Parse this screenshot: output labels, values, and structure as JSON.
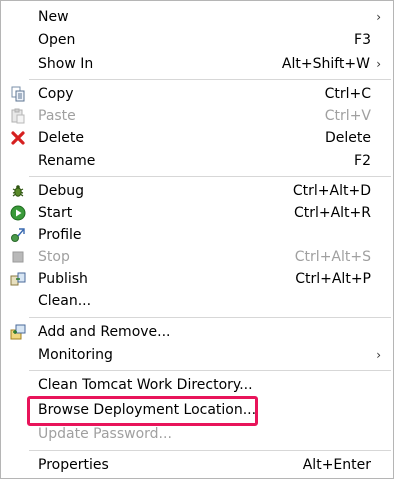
{
  "menu": {
    "new": {
      "label": "New",
      "arrow": "›"
    },
    "open": {
      "label": "Open",
      "shortcut": "F3"
    },
    "show_in": {
      "label": "Show In",
      "shortcut": "Alt+Shift+W",
      "arrow": "›"
    },
    "copy": {
      "label": "Copy",
      "shortcut": "Ctrl+C"
    },
    "paste": {
      "label": "Paste",
      "shortcut": "Ctrl+V"
    },
    "delete": {
      "label": "Delete",
      "shortcut": "Delete"
    },
    "rename": {
      "label": "Rename",
      "shortcut": "F2"
    },
    "debug": {
      "label": "Debug",
      "shortcut": "Ctrl+Alt+D"
    },
    "start": {
      "label": "Start",
      "shortcut": "Ctrl+Alt+R"
    },
    "profile": {
      "label": "Profile"
    },
    "stop": {
      "label": "Stop",
      "shortcut": "Ctrl+Alt+S"
    },
    "publish": {
      "label": "Publish",
      "shortcut": "Ctrl+Alt+P"
    },
    "clean": {
      "label": "Clean..."
    },
    "add_remove": {
      "label": "Add and Remove..."
    },
    "monitoring": {
      "label": "Monitoring",
      "arrow": "›"
    },
    "clean_tomcat": {
      "label": "Clean Tomcat Work Directory..."
    },
    "browse_deploy": {
      "label": "Browse Deployment Location..."
    },
    "update_password": {
      "label": "Update Password..."
    },
    "properties": {
      "label": "Properties",
      "shortcut": "Alt+Enter"
    }
  },
  "colors": {
    "highlight_border": "#e8145a",
    "disabled_text": "#a0a0a0",
    "separator": "#d7d7d7"
  }
}
